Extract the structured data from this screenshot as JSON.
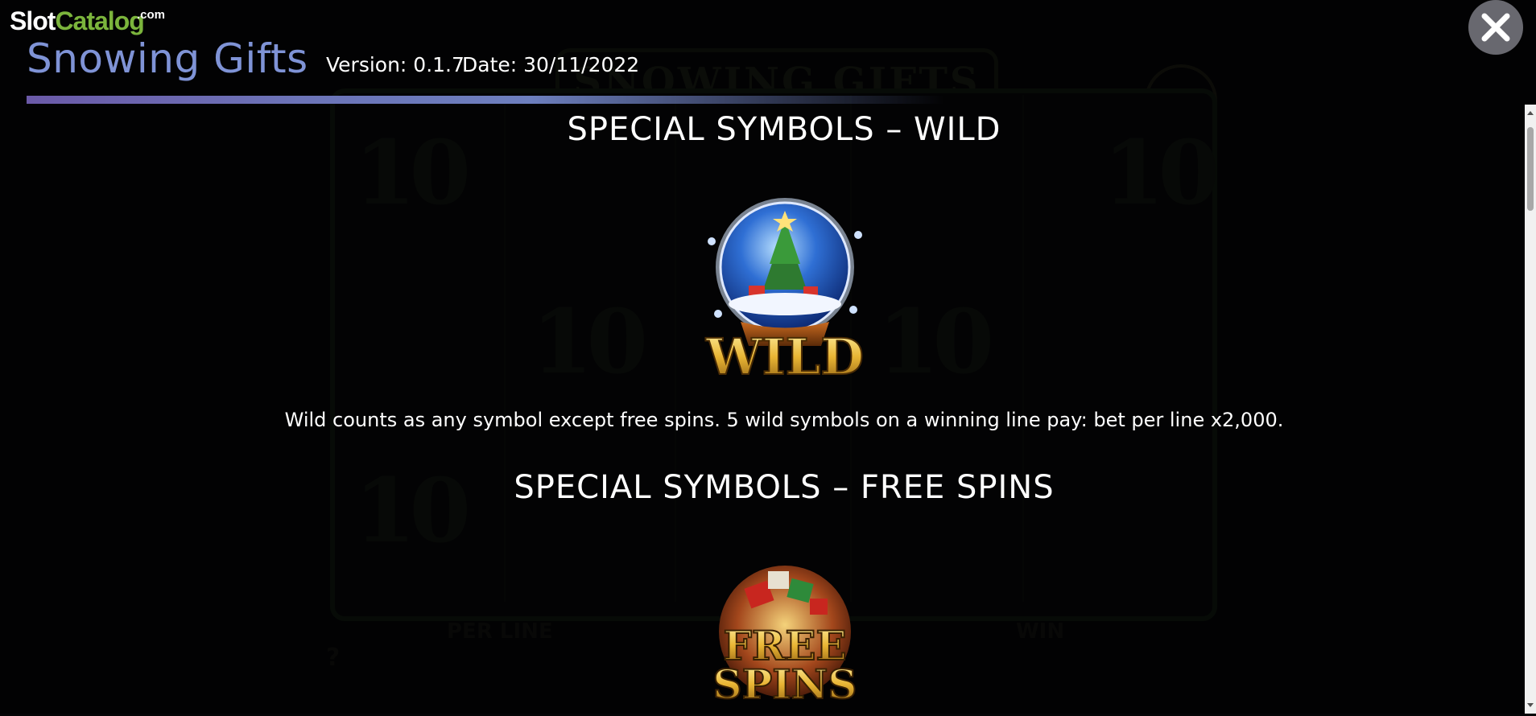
{
  "brand": {
    "logo_slot": "Slot",
    "logo_catalog": "Catalog",
    "logo_com": ".com"
  },
  "header": {
    "game_title": "Snowing Gifts",
    "version": "Version: 0.1.7",
    "date": "Date: 30/11/2022",
    "close_icon": "close-icon"
  },
  "sections": [
    {
      "title": "SPECIAL SYMBOLS – WILD",
      "symbol_text": "WILD",
      "description": "Wild counts as any symbol except free spins. 5 wild symbols on a winning line pay: bet per line x2,000."
    },
    {
      "title": "SPECIAL SYMBOLS – FREE SPINS",
      "symbol_text_line1": "FREE",
      "symbol_text_line2": "SPINS"
    }
  ],
  "colors": {
    "title_accent": "#7f93d6",
    "logo_green": "#7bb43c",
    "gradient_start": "#6b5aa8",
    "gold": "#e9b534"
  }
}
